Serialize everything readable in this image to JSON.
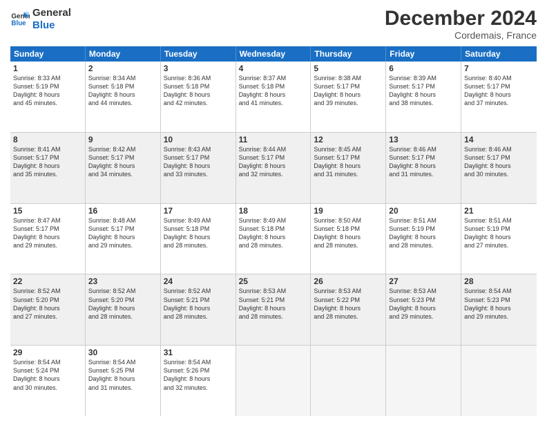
{
  "logo": {
    "line1": "General",
    "line2": "Blue"
  },
  "title": "December 2024",
  "subtitle": "Cordemais, France",
  "header_days": [
    "Sunday",
    "Monday",
    "Tuesday",
    "Wednesday",
    "Thursday",
    "Friday",
    "Saturday"
  ],
  "weeks": [
    [
      {
        "day": 1,
        "rise": "8:33 AM",
        "set": "5:19 PM",
        "daylight": "8 hours and 45 minutes.",
        "shaded": false
      },
      {
        "day": 2,
        "rise": "8:34 AM",
        "set": "5:18 PM",
        "daylight": "8 hours and 44 minutes.",
        "shaded": false
      },
      {
        "day": 3,
        "rise": "8:36 AM",
        "set": "5:18 PM",
        "daylight": "8 hours and 42 minutes.",
        "shaded": false
      },
      {
        "day": 4,
        "rise": "8:37 AM",
        "set": "5:18 PM",
        "daylight": "8 hours and 41 minutes.",
        "shaded": false
      },
      {
        "day": 5,
        "rise": "8:38 AM",
        "set": "5:17 PM",
        "daylight": "8 hours and 39 minutes.",
        "shaded": false
      },
      {
        "day": 6,
        "rise": "8:39 AM",
        "set": "5:17 PM",
        "daylight": "8 hours and 38 minutes.",
        "shaded": false
      },
      {
        "day": 7,
        "rise": "8:40 AM",
        "set": "5:17 PM",
        "daylight": "8 hours and 37 minutes.",
        "shaded": false
      }
    ],
    [
      {
        "day": 8,
        "rise": "8:41 AM",
        "set": "5:17 PM",
        "daylight": "8 hours and 35 minutes.",
        "shaded": true
      },
      {
        "day": 9,
        "rise": "8:42 AM",
        "set": "5:17 PM",
        "daylight": "8 hours and 34 minutes.",
        "shaded": true
      },
      {
        "day": 10,
        "rise": "8:43 AM",
        "set": "5:17 PM",
        "daylight": "8 hours and 33 minutes.",
        "shaded": true
      },
      {
        "day": 11,
        "rise": "8:44 AM",
        "set": "5:17 PM",
        "daylight": "8 hours and 32 minutes.",
        "shaded": true
      },
      {
        "day": 12,
        "rise": "8:45 AM",
        "set": "5:17 PM",
        "daylight": "8 hours and 31 minutes.",
        "shaded": true
      },
      {
        "day": 13,
        "rise": "8:46 AM",
        "set": "5:17 PM",
        "daylight": "8 hours and 31 minutes.",
        "shaded": true
      },
      {
        "day": 14,
        "rise": "8:46 AM",
        "set": "5:17 PM",
        "daylight": "8 hours and 30 minutes.",
        "shaded": true
      }
    ],
    [
      {
        "day": 15,
        "rise": "8:47 AM",
        "set": "5:17 PM",
        "daylight": "8 hours and 29 minutes.",
        "shaded": false
      },
      {
        "day": 16,
        "rise": "8:48 AM",
        "set": "5:17 PM",
        "daylight": "8 hours and 29 minutes.",
        "shaded": false
      },
      {
        "day": 17,
        "rise": "8:49 AM",
        "set": "5:18 PM",
        "daylight": "8 hours and 28 minutes.",
        "shaded": false
      },
      {
        "day": 18,
        "rise": "8:49 AM",
        "set": "5:18 PM",
        "daylight": "8 hours and 28 minutes.",
        "shaded": false
      },
      {
        "day": 19,
        "rise": "8:50 AM",
        "set": "5:18 PM",
        "daylight": "8 hours and 28 minutes.",
        "shaded": false
      },
      {
        "day": 20,
        "rise": "8:51 AM",
        "set": "5:19 PM",
        "daylight": "8 hours and 28 minutes.",
        "shaded": false
      },
      {
        "day": 21,
        "rise": "8:51 AM",
        "set": "5:19 PM",
        "daylight": "8 hours and 27 minutes.",
        "shaded": false
      }
    ],
    [
      {
        "day": 22,
        "rise": "8:52 AM",
        "set": "5:20 PM",
        "daylight": "8 hours and 27 minutes.",
        "shaded": true
      },
      {
        "day": 23,
        "rise": "8:52 AM",
        "set": "5:20 PM",
        "daylight": "8 hours and 28 minutes.",
        "shaded": true
      },
      {
        "day": 24,
        "rise": "8:52 AM",
        "set": "5:21 PM",
        "daylight": "8 hours and 28 minutes.",
        "shaded": true
      },
      {
        "day": 25,
        "rise": "8:53 AM",
        "set": "5:21 PM",
        "daylight": "8 hours and 28 minutes.",
        "shaded": true
      },
      {
        "day": 26,
        "rise": "8:53 AM",
        "set": "5:22 PM",
        "daylight": "8 hours and 28 minutes.",
        "shaded": true
      },
      {
        "day": 27,
        "rise": "8:53 AM",
        "set": "5:23 PM",
        "daylight": "8 hours and 29 minutes.",
        "shaded": true
      },
      {
        "day": 28,
        "rise": "8:54 AM",
        "set": "5:23 PM",
        "daylight": "8 hours and 29 minutes.",
        "shaded": true
      }
    ],
    [
      {
        "day": 29,
        "rise": "8:54 AM",
        "set": "5:24 PM",
        "daylight": "8 hours and 30 minutes.",
        "shaded": false
      },
      {
        "day": 30,
        "rise": "8:54 AM",
        "set": "5:25 PM",
        "daylight": "8 hours and 31 minutes.",
        "shaded": false
      },
      {
        "day": 31,
        "rise": "8:54 AM",
        "set": "5:26 PM",
        "daylight": "8 hours and 32 minutes.",
        "shaded": false
      },
      null,
      null,
      null,
      null
    ]
  ]
}
